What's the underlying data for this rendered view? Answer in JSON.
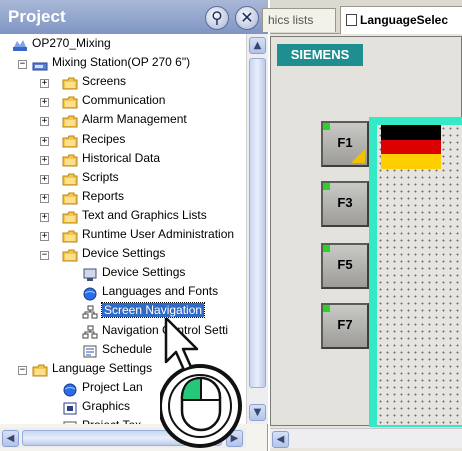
{
  "project": {
    "title": "Project",
    "pin_icon": "pin-icon",
    "close_icon": "close-icon",
    "pin_glyph": "⚲",
    "close_glyph": "✕",
    "tree": [
      {
        "label": "OP270_Mixing",
        "icon": "project-icon"
      },
      {
        "label": "Mixing Station(OP 270 6\")",
        "icon": "device-icon",
        "expanded": true
      },
      {
        "label": "Screens",
        "icon": "folder-icon"
      },
      {
        "label": "Communication",
        "icon": "folder-icon"
      },
      {
        "label": "Alarm Management",
        "icon": "folder-icon"
      },
      {
        "label": "Recipes",
        "icon": "folder-icon"
      },
      {
        "label": "Historical Data",
        "icon": "folder-icon"
      },
      {
        "label": "Scripts",
        "icon": "folder-icon"
      },
      {
        "label": "Reports",
        "icon": "folder-icon"
      },
      {
        "label": "Text and Graphics Lists",
        "icon": "folder-icon"
      },
      {
        "label": "Runtime User Administration",
        "icon": "folder-icon"
      },
      {
        "label": "Device Settings",
        "icon": "folder-icon",
        "expanded": true
      },
      {
        "label": "Device Settings",
        "icon": "monitor-icon"
      },
      {
        "label": "Languages and Fonts",
        "icon": "globe-icon"
      },
      {
        "label": "Screen Navigation",
        "icon": "navigation-icon",
        "selected": true
      },
      {
        "label": "Navigation Control Setti",
        "icon": "navigation-icon"
      },
      {
        "label": "Schedule",
        "icon": "schedule-icon"
      },
      {
        "label": "Language Settings",
        "icon": "folder-icon",
        "expanded": true
      },
      {
        "label": "Project Lan",
        "icon": "globe-icon"
      },
      {
        "label": "Graphics",
        "icon": "graphics-icon"
      },
      {
        "label": "Project Tex",
        "icon": "text-icon"
      }
    ]
  },
  "editor": {
    "tabs": [
      {
        "label": "hics lists"
      },
      {
        "label": "LanguageSelec"
      }
    ],
    "brand": "SIEMENS",
    "function_keys": [
      "F1",
      "F3",
      "F5",
      "F7"
    ],
    "colors": {
      "panel_frame": "#33e9c6",
      "brand_bar": "#1f8e90",
      "flag_black": "#000000",
      "flag_red": "#dd0000",
      "flag_gold": "#ffce00"
    }
  },
  "cursor": {
    "icon": "mouse-click-icon"
  }
}
